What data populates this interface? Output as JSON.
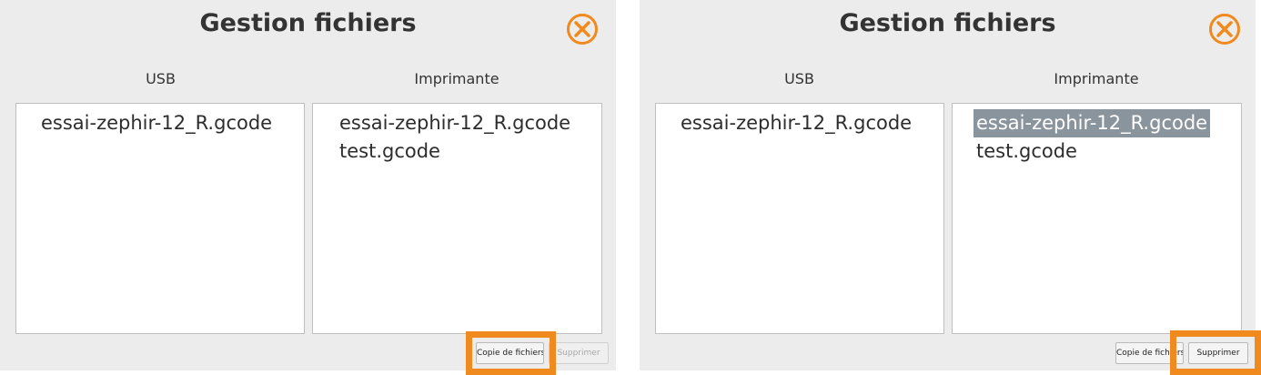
{
  "accent": "#f08a1e",
  "panels": [
    {
      "title": "Gestion fichiers",
      "close_icon": "close-circle-x-icon",
      "usb_label": "USB",
      "printer_label": "Imprimante",
      "usb_files": [
        "essai-zephir-12_R.gcode"
      ],
      "printer_files": [
        "essai-zephir-12_R.gcode",
        "test.gcode"
      ],
      "copy_button": "Copie de fichiers",
      "delete_button": "Supprimer",
      "highlighted_button": "copy"
    },
    {
      "title": "Gestion fichiers",
      "close_icon": "close-circle-x-icon",
      "usb_label": "USB",
      "printer_label": "Imprimante",
      "usb_files": [
        "essai-zephir-12_R.gcode"
      ],
      "printer_files": [
        "essai-zephir-12_R.gcode",
        "test.gcode"
      ],
      "selected_printer_file": "essai-zephir-12_R.gcode",
      "copy_button": "Copie de fichiers",
      "delete_button": "Supprimer",
      "highlighted_button": "delete"
    }
  ]
}
